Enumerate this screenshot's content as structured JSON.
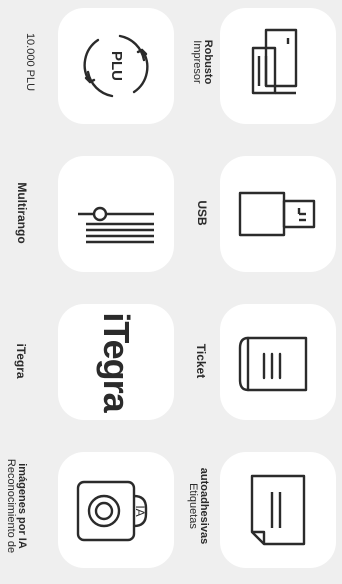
{
  "features": [
    {
      "icon": "printer-icon",
      "label_bold": "Robusto",
      "label_normal": "Impresor"
    },
    {
      "icon": "plu-cycle-icon",
      "label_bold": "",
      "label_normal": "10.000 PLU"
    },
    {
      "icon": "usb-icon",
      "label_bold": "USB",
      "label_normal": ""
    },
    {
      "icon": "multirange-icon",
      "label_bold": "Multirango",
      "label_normal": ""
    },
    {
      "icon": "ticket-icon",
      "label_bold": "Ticket",
      "label_normal": ""
    },
    {
      "icon": "itegra-logo",
      "label_bold": "iTegra",
      "label_normal": ""
    },
    {
      "icon": "label-sheet-icon",
      "label_bold": "autoadhesivas",
      "label_normal": "Etiquetas"
    },
    {
      "icon": "camera-ai-icon",
      "label_bold": "imágenes por IA",
      "label_normal": "Reconocimiento de"
    }
  ],
  "plu_text": "PLU",
  "ia_text": "IA",
  "itegra_logo_text": "iTegra"
}
